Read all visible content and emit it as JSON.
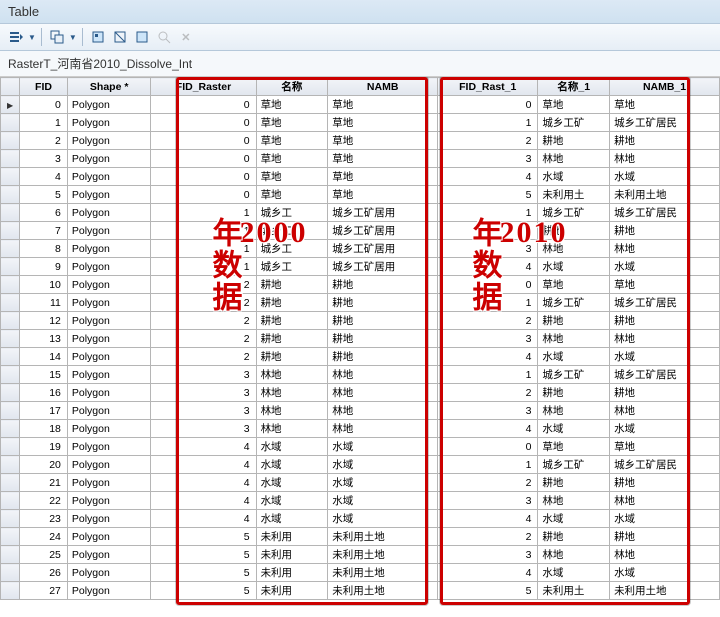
{
  "window": {
    "title": "Table"
  },
  "subtitle": "RasterT_河南省2010_Dissolve_Int",
  "toolbar": {
    "btn1": "list-icon",
    "btn2": "layers-icon",
    "btn3": "add-field-icon",
    "btn4": "select-icon",
    "btn5": "query-icon",
    "btn6": "find-icon",
    "btn7": "close-icon"
  },
  "columns": {
    "fid": "FID",
    "shape": "Shape *",
    "fid_raster": "FID_Raster",
    "mc": "名称",
    "namb": "NAMB",
    "fid_rast1": "FID_Rast_1",
    "mc1": "名称_1",
    "namb1": "NAMB_1"
  },
  "overlay": {
    "left": "2000年数据",
    "right": "2010年数据"
  },
  "rows": [
    {
      "fid": 0,
      "shape": "Polygon",
      "fr": 0,
      "mc": "草地",
      "namb": "草地",
      "fr1": 0,
      "mc1": "草地",
      "namb1": "草地"
    },
    {
      "fid": 1,
      "shape": "Polygon",
      "fr": 0,
      "mc": "草地",
      "namb": "草地",
      "fr1": 1,
      "mc1": "城乡工矿",
      "namb1": "城乡工矿居民"
    },
    {
      "fid": 2,
      "shape": "Polygon",
      "fr": 0,
      "mc": "草地",
      "namb": "草地",
      "fr1": 2,
      "mc1": "耕地",
      "namb1": "耕地"
    },
    {
      "fid": 3,
      "shape": "Polygon",
      "fr": 0,
      "mc": "草地",
      "namb": "草地",
      "fr1": 3,
      "mc1": "林地",
      "namb1": "林地"
    },
    {
      "fid": 4,
      "shape": "Polygon",
      "fr": 0,
      "mc": "草地",
      "namb": "草地",
      "fr1": 4,
      "mc1": "水域",
      "namb1": "水域"
    },
    {
      "fid": 5,
      "shape": "Polygon",
      "fr": 0,
      "mc": "草地",
      "namb": "草地",
      "fr1": 5,
      "mc1": "未利用土",
      "namb1": "未利用土地"
    },
    {
      "fid": 6,
      "shape": "Polygon",
      "fr": 1,
      "mc": "城乡工",
      "namb": "城乡工矿居用",
      "fr1": 1,
      "mc1": "城乡工矿",
      "namb1": "城乡工矿居民"
    },
    {
      "fid": 7,
      "shape": "Polygon",
      "fr": 1,
      "mc": "城乡工",
      "namb": "城乡工矿居用",
      "fr1": 2,
      "mc1": "耕地",
      "namb1": "耕地"
    },
    {
      "fid": 8,
      "shape": "Polygon",
      "fr": 1,
      "mc": "城乡工",
      "namb": "城乡工矿居用",
      "fr1": 3,
      "mc1": "林地",
      "namb1": "林地"
    },
    {
      "fid": 9,
      "shape": "Polygon",
      "fr": 1,
      "mc": "城乡工",
      "namb": "城乡工矿居用",
      "fr1": 4,
      "mc1": "水域",
      "namb1": "水域"
    },
    {
      "fid": 10,
      "shape": "Polygon",
      "fr": 2,
      "mc": "耕地",
      "namb": "耕地",
      "fr1": 0,
      "mc1": "草地",
      "namb1": "草地"
    },
    {
      "fid": 11,
      "shape": "Polygon",
      "fr": 2,
      "mc": "耕地",
      "namb": "耕地",
      "fr1": 1,
      "mc1": "城乡工矿",
      "namb1": "城乡工矿居民"
    },
    {
      "fid": 12,
      "shape": "Polygon",
      "fr": 2,
      "mc": "耕地",
      "namb": "耕地",
      "fr1": 2,
      "mc1": "耕地",
      "namb1": "耕地"
    },
    {
      "fid": 13,
      "shape": "Polygon",
      "fr": 2,
      "mc": "耕地",
      "namb": "耕地",
      "fr1": 3,
      "mc1": "林地",
      "namb1": "林地"
    },
    {
      "fid": 14,
      "shape": "Polygon",
      "fr": 2,
      "mc": "耕地",
      "namb": "耕地",
      "fr1": 4,
      "mc1": "水域",
      "namb1": "水域"
    },
    {
      "fid": 15,
      "shape": "Polygon",
      "fr": 3,
      "mc": "林地",
      "namb": "林地",
      "fr1": 1,
      "mc1": "城乡工矿",
      "namb1": "城乡工矿居民"
    },
    {
      "fid": 16,
      "shape": "Polygon",
      "fr": 3,
      "mc": "林地",
      "namb": "林地",
      "fr1": 2,
      "mc1": "耕地",
      "namb1": "耕地"
    },
    {
      "fid": 17,
      "shape": "Polygon",
      "fr": 3,
      "mc": "林地",
      "namb": "林地",
      "fr1": 3,
      "mc1": "林地",
      "namb1": "林地"
    },
    {
      "fid": 18,
      "shape": "Polygon",
      "fr": 3,
      "mc": "林地",
      "namb": "林地",
      "fr1": 4,
      "mc1": "水域",
      "namb1": "水域"
    },
    {
      "fid": 19,
      "shape": "Polygon",
      "fr": 4,
      "mc": "水域",
      "namb": "水域",
      "fr1": 0,
      "mc1": "草地",
      "namb1": "草地"
    },
    {
      "fid": 20,
      "shape": "Polygon",
      "fr": 4,
      "mc": "水域",
      "namb": "水域",
      "fr1": 1,
      "mc1": "城乡工矿",
      "namb1": "城乡工矿居民"
    },
    {
      "fid": 21,
      "shape": "Polygon",
      "fr": 4,
      "mc": "水域",
      "namb": "水域",
      "fr1": 2,
      "mc1": "耕地",
      "namb1": "耕地"
    },
    {
      "fid": 22,
      "shape": "Polygon",
      "fr": 4,
      "mc": "水域",
      "namb": "水域",
      "fr1": 3,
      "mc1": "林地",
      "namb1": "林地"
    },
    {
      "fid": 23,
      "shape": "Polygon",
      "fr": 4,
      "mc": "水域",
      "namb": "水域",
      "fr1": 4,
      "mc1": "水域",
      "namb1": "水域"
    },
    {
      "fid": 24,
      "shape": "Polygon",
      "fr": 5,
      "mc": "未利用",
      "namb": "未利用土地",
      "fr1": 2,
      "mc1": "耕地",
      "namb1": "耕地"
    },
    {
      "fid": 25,
      "shape": "Polygon",
      "fr": 5,
      "mc": "未利用",
      "namb": "未利用土地",
      "fr1": 3,
      "mc1": "林地",
      "namb1": "林地"
    },
    {
      "fid": 26,
      "shape": "Polygon",
      "fr": 5,
      "mc": "未利用",
      "namb": "未利用土地",
      "fr1": 4,
      "mc1": "水域",
      "namb1": "水域"
    },
    {
      "fid": 27,
      "shape": "Polygon",
      "fr": 5,
      "mc": "未利用",
      "namb": "未利用土地",
      "fr1": 5,
      "mc1": "未利用土",
      "namb1": "未利用土地"
    }
  ]
}
